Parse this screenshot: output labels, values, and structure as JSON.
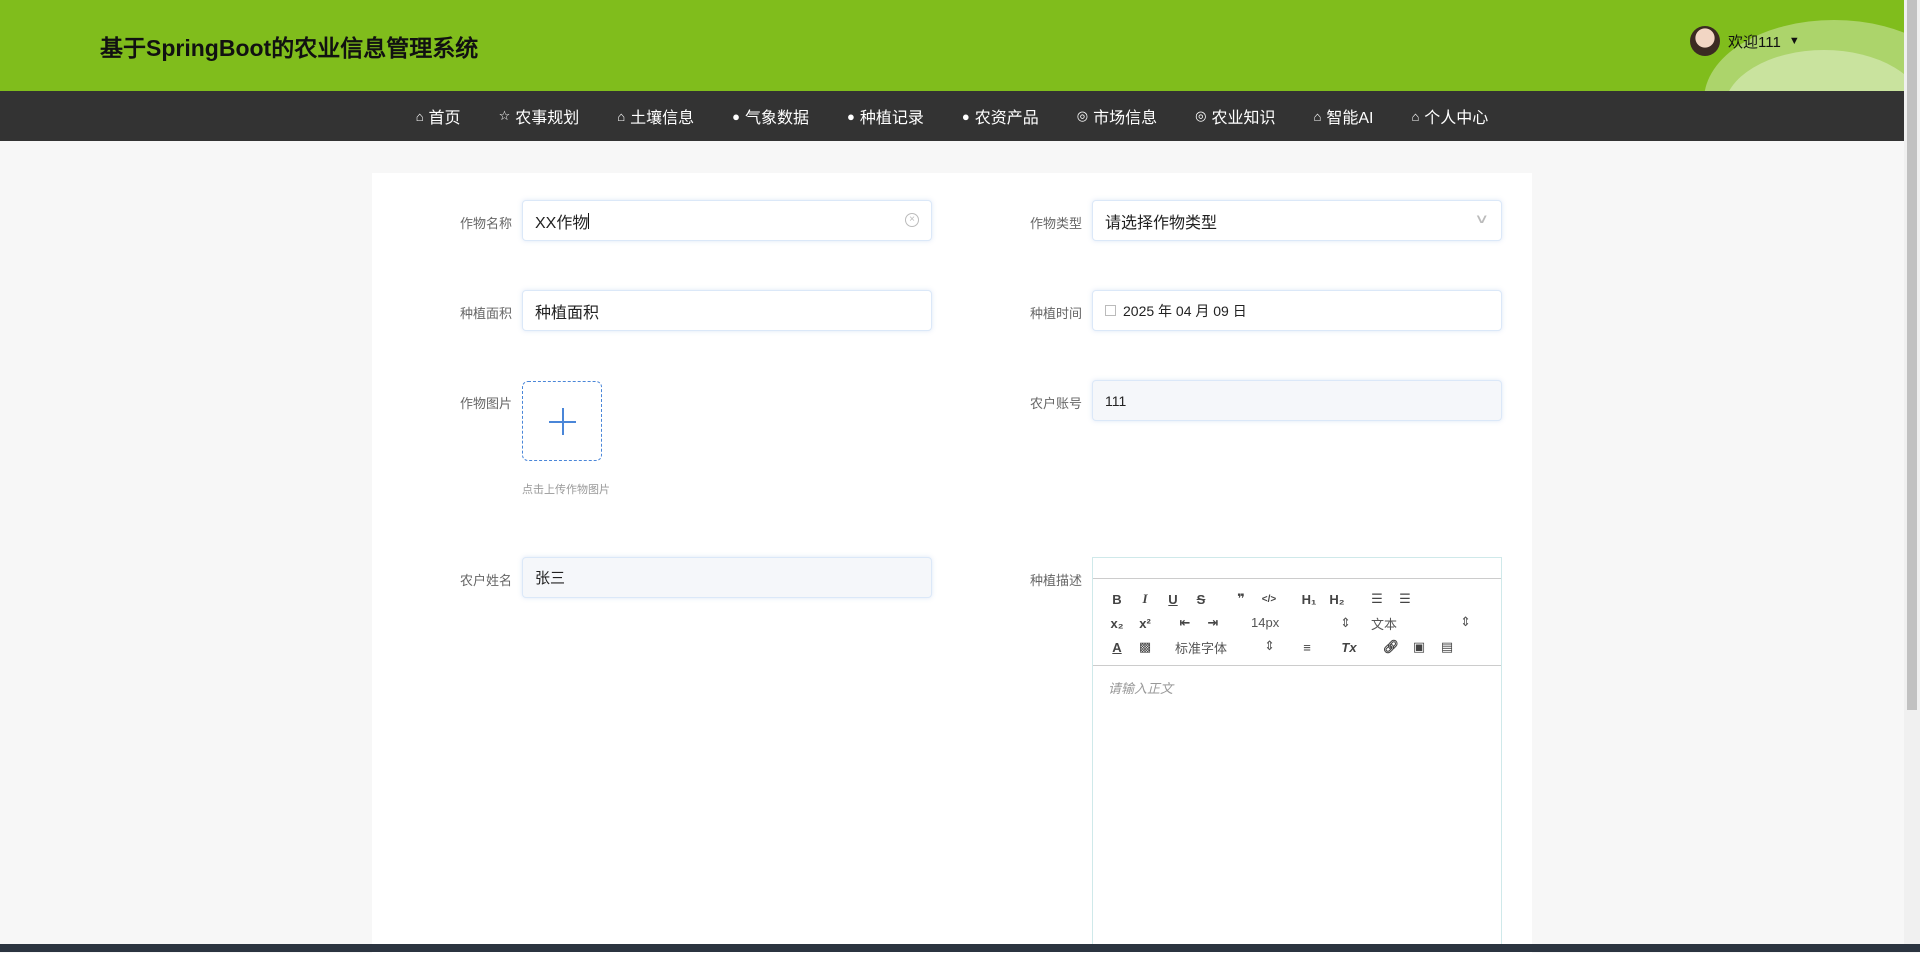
{
  "header": {
    "title": "基于SpringBoot的农业信息管理系统",
    "user_label": "欢迎111",
    "dropdown_icon": "▼"
  },
  "nav": [
    {
      "icon": "⌂",
      "label": "首页"
    },
    {
      "icon": "☆",
      "label": "农事规划"
    },
    {
      "icon": "⌂",
      "label": "土壤信息"
    },
    {
      "icon": "●",
      "label": "气象数据"
    },
    {
      "icon": "●",
      "label": "种植记录"
    },
    {
      "icon": "●",
      "label": "农资产品"
    },
    {
      "icon": "◎",
      "label": "市场信息"
    },
    {
      "icon": "◎",
      "label": "农业知识"
    },
    {
      "icon": "⌂",
      "label": "智能AI"
    },
    {
      "icon": "⌂",
      "label": "个人中心"
    }
  ],
  "form": {
    "crop_name": {
      "label": "作物名称",
      "value": "XX作物"
    },
    "crop_type": {
      "label": "作物类型",
      "placeholder": "请选择作物类型"
    },
    "area": {
      "label": "种植面积",
      "placeholder": "种植面积"
    },
    "time": {
      "label": "种植时间",
      "value": "2025 年 04 月 09 日"
    },
    "image": {
      "label": "作物图片",
      "hint": "点击上传作物图片"
    },
    "account": {
      "label": "农户账号",
      "value": "111"
    },
    "name": {
      "label": "农户姓名",
      "value": "张三"
    },
    "desc": {
      "label": "种植描述",
      "placeholder": "请输入正文",
      "font_size": "14px",
      "heading": "文本",
      "font": "标准字体"
    }
  }
}
